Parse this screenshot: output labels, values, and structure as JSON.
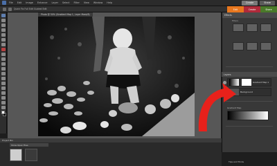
{
  "menu": {
    "items": [
      "File",
      "Edit",
      "Image",
      "Enhance",
      "Layer",
      "Select",
      "Filter",
      "View",
      "Window",
      "Help"
    ],
    "create_label": "Create",
    "share_label": "Share"
  },
  "options": {
    "caption": "Quick Fix  Full Edit  Guided Edit"
  },
  "mode_tabs": {
    "edit": "Edit",
    "create": "Create",
    "share": "Share"
  },
  "document": {
    "tab_title": "Photo @ 50% (Gradient Map 1, Layer Mask/8)"
  },
  "panel": {
    "effects_header": "Effects",
    "effects_label": "Filters",
    "layers_header": "Layers",
    "layer1": "Gradient Map 1",
    "layer2": "Background",
    "gradient_label": "Gradient Map"
  },
  "bin": {
    "header": "Project Bin",
    "dropdown": "Show Open Files"
  },
  "status": {
    "tips": "Tips and Tricks"
  },
  "colors": {
    "edit_tab": "#e8771e",
    "create_tab": "#b02a3a",
    "share_tab": "#4a7a2a",
    "arrow": "#e8211b"
  }
}
